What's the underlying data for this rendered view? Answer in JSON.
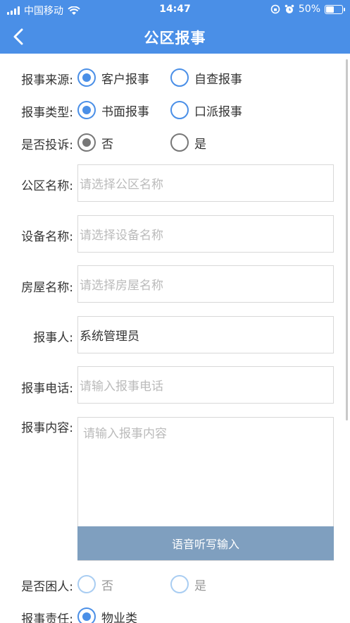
{
  "status_bar": {
    "carrier": "中国移动",
    "time": "14:47",
    "battery_percent": "50%",
    "battery_level": 0.5
  },
  "nav": {
    "title": "公区报事",
    "back_icon": "chevron-left-icon"
  },
  "form": {
    "source": {
      "label": "报事来源:",
      "options": [
        "客户报事",
        "自查报事"
      ],
      "selected": "客户报事"
    },
    "type": {
      "label": "报事类型:",
      "options": [
        "书面报事",
        "口派报事"
      ],
      "selected": "书面报事"
    },
    "complaint": {
      "label": "是否投诉:",
      "options": [
        "否",
        "是"
      ],
      "selected": "否"
    },
    "area_name": {
      "label": "公区名称:",
      "placeholder": "请选择公区名称",
      "value": ""
    },
    "device_name": {
      "label": "设备名称:",
      "placeholder": "请选择设备名称",
      "value": ""
    },
    "house_name": {
      "label": "房屋名称:",
      "placeholder": "请选择房屋名称",
      "value": ""
    },
    "reporter": {
      "label": "报事人:",
      "value": "系统管理员"
    },
    "phone": {
      "label": "报事电话:",
      "placeholder": "请输入报事电话",
      "value": ""
    },
    "content": {
      "label": "报事内容:",
      "placeholder": "请输入报事内容",
      "voice_button": "语音听写输入"
    },
    "hardship": {
      "label": "是否困人:",
      "options": [
        "否",
        "是"
      ],
      "selected": ""
    },
    "responsibility": {
      "label": "报事责任:",
      "options": [
        "物业类"
      ],
      "selected": "物业类"
    }
  },
  "colors": {
    "primary": "#4a8fe7",
    "voice_button": "#7f9fbf",
    "placeholder": "#bbbbbb"
  }
}
